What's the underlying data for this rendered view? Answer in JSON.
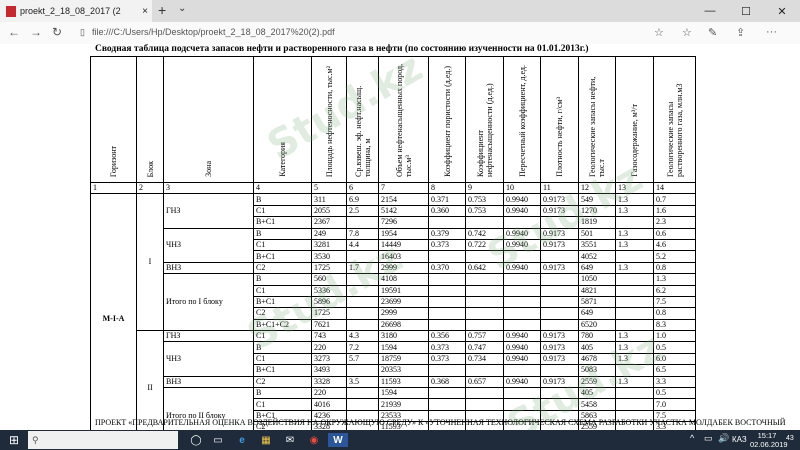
{
  "browser": {
    "tab_title": "proekt_2_18_08_2017 (2",
    "tab_close": "×",
    "new_tab": "+",
    "tab_dropdown": "⌄",
    "minimize": "—",
    "maximize": "☐",
    "close": "✕",
    "back": "←",
    "forward": "→",
    "refresh": "↻",
    "url": "file:///C:/Users/Hp/Desktop/proekt_2_18_08_2017%20(2).pdf",
    "favorite": "☆",
    "collections": "☆",
    "read": "✎",
    "share": "⇪",
    "more": "···"
  },
  "document": {
    "title": "Сводная таблица подсчета запасов нефти и растворенного газа в нефти (по состоянию изученности на 01.01.2013г.)",
    "headers": [
      "Горизонт",
      "Блок",
      "Зона",
      "Категория",
      "Площадь нефтеносности, тыс.м²",
      "Ср.взвеш. эф. нефт.насыщ. толщина, м",
      "Объем нефтенасыщенных пород, тыс.м³",
      "Коэффициент пористости (д.ед.)",
      "Коэффициент нефтенасыщенности (д.ед.)",
      "Пересчетный коэффициент, д.ед.",
      "Плотность нефти, г/см³",
      "Геологические запасы нефти, тыс.т",
      "Газосодержание, м³/т",
      "Геологические запасы растворенного газа, млн.м3"
    ],
    "col_numbers": [
      "1",
      "2",
      "3",
      "4",
      "5",
      "6",
      "7",
      "8",
      "9",
      "10",
      "11",
      "12",
      "13",
      "14"
    ],
    "horizon": "М-І-А",
    "block_i": "І",
    "block_ii": "ІІ",
    "zones": {
      "gnz1": "ГНЗ",
      "chnz1": "ЧНЗ",
      "vnz1": "ВНЗ",
      "total1": "Итого по І блоку",
      "gnz2": "ГНЗ",
      "chnz2": "ЧНЗ",
      "vnz2": "ВНЗ",
      "total2": "Итого по ІІ блоку",
      "gnz3": "ГНЗ"
    },
    "rows": [
      [
        "B",
        "311",
        "6.9",
        "2154",
        "0.371",
        "0.753",
        "0.9940",
        "0.9173",
        "549",
        "1.3",
        "0.7"
      ],
      [
        "C1",
        "2055",
        "2.5",
        "5142",
        "0.360",
        "0.753",
        "0.9940",
        "0.9173",
        "1270",
        "1.3",
        "1.6"
      ],
      [
        "B+C1",
        "2367",
        "",
        "7296",
        "",
        "",
        "",
        "",
        "1819",
        "",
        "2.3"
      ],
      [
        "B",
        "249",
        "7.8",
        "1954",
        "0.379",
        "0.742",
        "0.9940",
        "0.9173",
        "501",
        "1.3",
        "0.6"
      ],
      [
        "C1",
        "3281",
        "4.4",
        "14449",
        "0.373",
        "0.722",
        "0.9940",
        "0.9173",
        "3551",
        "1.3",
        "4.6"
      ],
      [
        "B+C1",
        "3530",
        "",
        "16403",
        "",
        "",
        "",
        "",
        "4052",
        "",
        "5.2"
      ],
      [
        "C2",
        "1725",
        "1.7",
        "2999",
        "0.370",
        "0.642",
        "0.9940",
        "0.9173",
        "649",
        "1.3",
        "0.8"
      ],
      [
        "B",
        "560",
        "",
        "4108",
        "",
        "",
        "",
        "",
        "1050",
        "",
        "1.3"
      ],
      [
        "C1",
        "5336",
        "",
        "19591",
        "",
        "",
        "",
        "",
        "4821",
        "",
        "6.2"
      ],
      [
        "B+C1",
        "5896",
        "",
        "23699",
        "",
        "",
        "",
        "",
        "5871",
        "",
        "7.5"
      ],
      [
        "C2",
        "1725",
        "",
        "2999",
        "",
        "",
        "",
        "",
        "649",
        "",
        "0.8"
      ],
      [
        "B+C1+C2",
        "7621",
        "",
        "26698",
        "",
        "",
        "",
        "",
        "6520",
        "",
        "8.3"
      ],
      [
        "C1",
        "743",
        "4.3",
        "3180",
        "0.356",
        "0.757",
        "0.9940",
        "0.9173",
        "780",
        "1.3",
        "1.0"
      ],
      [
        "B",
        "220",
        "7.2",
        "1594",
        "0.373",
        "0.747",
        "0.9940",
        "0.9173",
        "405",
        "1.3",
        "0.5"
      ],
      [
        "C1",
        "3273",
        "5.7",
        "18759",
        "0.373",
        "0.734",
        "0.9940",
        "0.9173",
        "4678",
        "1.3",
        "6.0"
      ],
      [
        "B+C1",
        "3493",
        "",
        "20353",
        "",
        "",
        "",
        "",
        "5083",
        "",
        "6.5"
      ],
      [
        "C2",
        "3328",
        "3.5",
        "11593",
        "0.368",
        "0.657",
        "0.9940",
        "0.9173",
        "2559",
        "1.3",
        "3.3"
      ],
      [
        "B",
        "220",
        "",
        "1594",
        "",
        "",
        "",
        "",
        "405",
        "",
        "0.5"
      ],
      [
        "C1",
        "4016",
        "",
        "21939",
        "",
        "",
        "",
        "",
        "5458",
        "",
        "7.0"
      ],
      [
        "B+C1",
        "4236",
        "",
        "23533",
        "",
        "",
        "",
        "",
        "5863",
        "",
        "7.5"
      ],
      [
        "C2",
        "3328",
        "",
        "11593",
        "",
        "",
        "",
        "",
        "2559",
        "",
        "3.3"
      ],
      [
        "B+C1+C2",
        "7564",
        "",
        "35126",
        "",
        "",
        "",
        "",
        "8422",
        "",
        "10.8"
      ],
      [
        "B",
        "85",
        "10.6",
        "904",
        "0.367",
        "0.744",
        "0.9940",
        "0.9173",
        "225",
        "1.3",
        "0.3"
      ]
    ],
    "block_iii": "ІІІ",
    "footer": "ПРОЕКТ «ПРЕДВАРИТЕЛЬНАЯ ОЦЕНКА ВОЗДЕЙСТВИЯ НА ОКРУЖАЮЩУЮ СРЕДУ» К «УТОЧНЕННАЯ ТЕХНОЛОГИЧЕСКАЯ СХЕМА РАЗРАБОТКИ УЧАСТКА МОЛДАБЕК ВОСТОЧНЫЙ",
    "watermark": "Stud.kz"
  },
  "taskbar": {
    "start": "⊞",
    "search_placeholder": "",
    "apps": [
      "◯",
      "▭",
      "e",
      "▦",
      "✉",
      "◉",
      "W"
    ],
    "tray": [
      "^",
      "▭",
      "🔊",
      "КАЗ"
    ],
    "time": "15:17",
    "date": "02.06.2019",
    "notif_count": "43"
  }
}
